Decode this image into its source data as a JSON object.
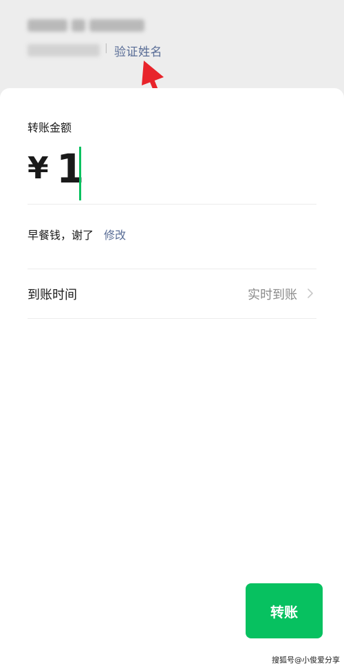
{
  "header": {
    "verify_label": "验证姓名"
  },
  "amount": {
    "label": "转账金额",
    "currency": "¥",
    "value": "1"
  },
  "remark": {
    "text": "早餐钱，谢了",
    "edit_label": "修改"
  },
  "arrival": {
    "label": "到账时间",
    "value": "实时到账"
  },
  "actions": {
    "transfer_label": "转账"
  },
  "watermark": "搜狐号@小俊爱分享",
  "colors": {
    "accent_green": "#07c160",
    "link_blue": "#576b95",
    "annotation_red": "#e8242b"
  },
  "icons": {
    "arrival_chevron": "chevron-right-icon",
    "annotation": "red-arrow-icon"
  }
}
